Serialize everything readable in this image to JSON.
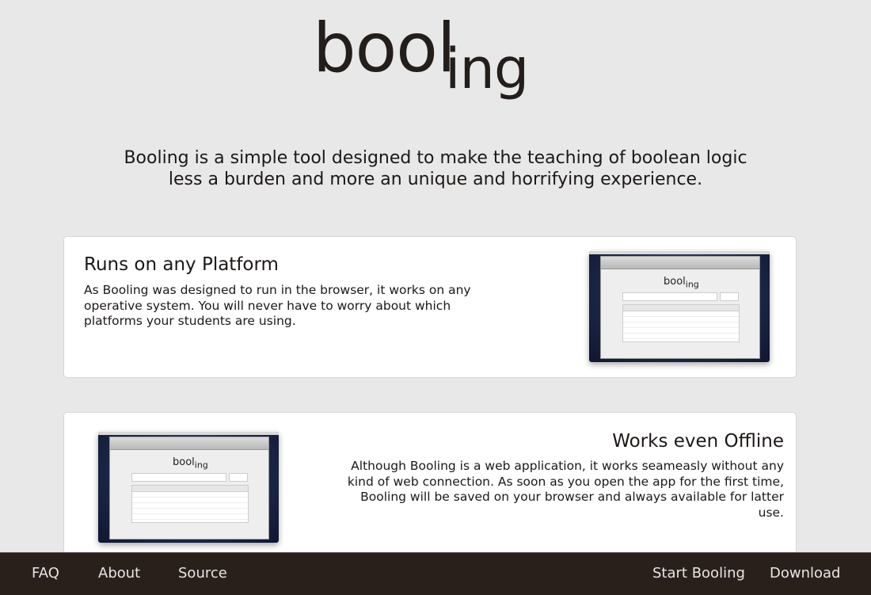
{
  "logo": {
    "part1": "bool",
    "part2": "ing"
  },
  "tagline": "Booling is a simple tool designed to make the teaching of boolean logic less a burden and more an unique and horrifying experience.",
  "features": [
    {
      "title": "Runs on any Platform",
      "text": "As Booling was designed to run in the browser, it works on any operative system. You will never have to worry about which platforms your students are using."
    },
    {
      "title": "Works even Offline",
      "text": "Although Booling is a web application, it works seameasly without any kind of web connection. As soon as you open the app for the first time, Booling will be saved on your browser and always available for latter use."
    }
  ],
  "screenshot_logo": {
    "part1": "bool",
    "part2": "ing"
  },
  "footer": {
    "faq": "FAQ",
    "about": "About",
    "source": "Source",
    "start": "Start Booling",
    "download": "Download"
  }
}
